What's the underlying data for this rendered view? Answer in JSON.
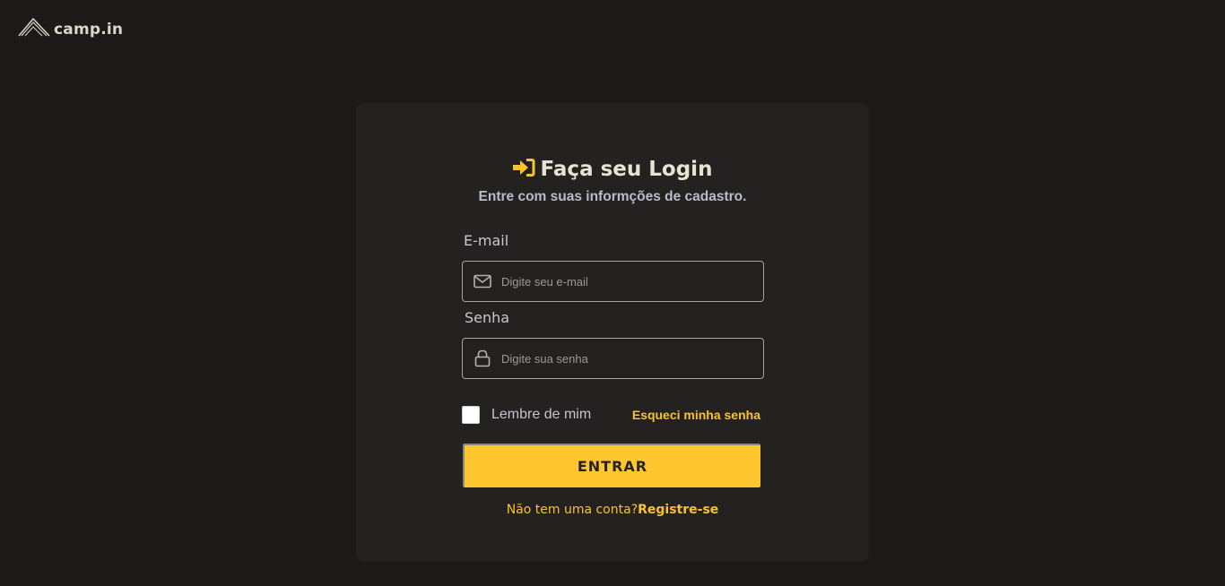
{
  "brand": {
    "name": "camp.in"
  },
  "login": {
    "title": "Faça seu Login",
    "subtitle": "Entre com suas informções de cadastro.",
    "email": {
      "label": "E-mail",
      "placeholder": "Digite seu e-mail",
      "value": ""
    },
    "password": {
      "label": "Senha",
      "placeholder": "Digite sua senha",
      "value": ""
    },
    "remember_me": {
      "label": "Lembre de mim",
      "checked": false
    },
    "forgot_password_label": "Esqueci minha senha",
    "submit_label": "ENTRAR",
    "signup_prompt": "Não tem uma conta?",
    "signup_link_label": "Registre-se"
  },
  "colors": {
    "background": "#1b1a19",
    "card": "#242220",
    "accent": "#ffc630",
    "title_text": "#e8e2d3",
    "subtitle_text": "#b9bccb"
  },
  "icons": {
    "logo": "tent-icon",
    "title": "sign-in-icon",
    "email": "mail-icon",
    "password": "lock-icon"
  }
}
